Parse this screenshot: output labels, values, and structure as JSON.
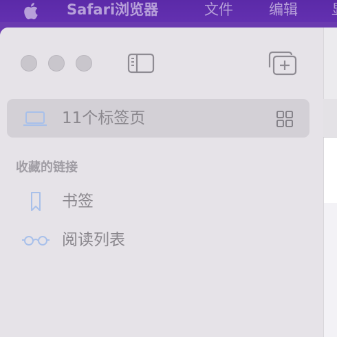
{
  "menubar": {
    "app_name": "Safari浏览器",
    "file": "文件",
    "edit": "编辑",
    "more": "显"
  },
  "window": {
    "toolbar": {
      "sidebar_toggle_icon": "sidebar-icon",
      "new_tab_group_icon": "new-tab-group-icon"
    },
    "tabs_row": {
      "icon": "laptop-icon",
      "label": "11个标签页",
      "overview_icon": "tab-overview-grid-icon"
    },
    "favorites": {
      "title": "收藏的链接",
      "items": [
        {
          "label": "书签",
          "icon": "bookmark-icon"
        },
        {
          "label": "阅读列表",
          "icon": "reading-glasses-icon"
        }
      ]
    }
  },
  "colors": {
    "menubar": "#5b2aa8",
    "sidebar": "#e6e3e8",
    "accent_icon": "#a8c0ea",
    "text_muted": "#8a878d"
  }
}
